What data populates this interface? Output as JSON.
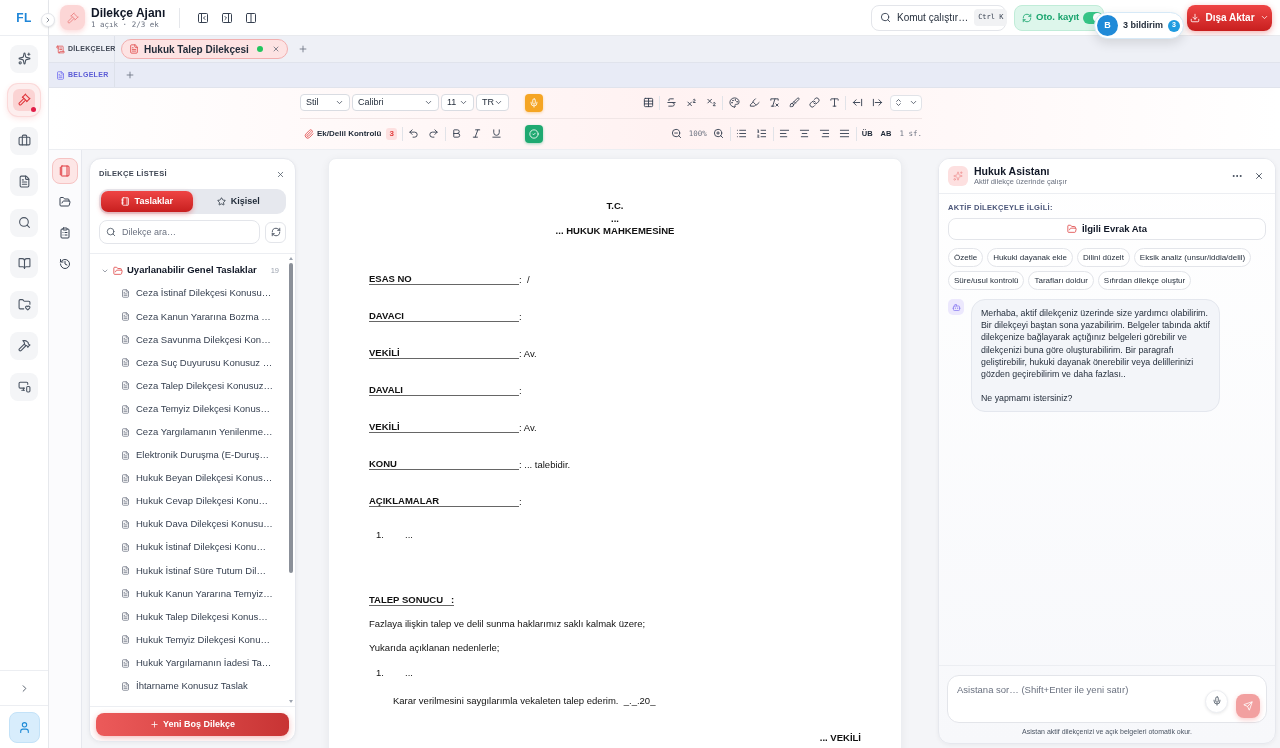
{
  "rail": {
    "logo": "FL",
    "items": [
      {
        "selected": false,
        "alert": false
      },
      {
        "selected": true,
        "alert": true
      },
      {
        "selected": false,
        "alert": false
      },
      {
        "selected": false,
        "alert": false
      },
      {
        "selected": false,
        "alert": false
      },
      {
        "selected": false,
        "alert": false
      },
      {
        "selected": false,
        "alert": false
      },
      {
        "selected": false,
        "alert": false
      },
      {
        "selected": false,
        "alert": false
      }
    ]
  },
  "topbar": {
    "title": "Dilekçe Ajanı",
    "subtitle": "1 açık · 2/3 ek",
    "command": {
      "label": "Komut çalıştır…",
      "shortcut": "Ctrl K"
    },
    "autosave": {
      "label": "Oto. kayıt",
      "on": true
    },
    "export_button": "Dışa Aktar",
    "notification": {
      "initial": "B",
      "label": "3 bildirim",
      "count": "3"
    }
  },
  "tab_groups": [
    {
      "kind": "petitions",
      "label": "DİLEKÇELER",
      "tabs": [
        {
          "label": "Hukuk Talep Dilekçesi",
          "selected": true,
          "saved": true
        }
      ]
    },
    {
      "kind": "documents",
      "label": "BELGELER"
    }
  ],
  "toolbar": {
    "style": "Stil",
    "font": "Calibri",
    "size": "11",
    "language": "TR",
    "evidence_check": {
      "label": "Ek/Delil Kontrolü",
      "count": "3"
    },
    "zoom": "100%",
    "case_buttons": [
      "ÜB",
      "AB"
    ],
    "page_count": "1 sf."
  },
  "panel_rail": {
    "items": [
      {
        "selected": true
      },
      {
        "selected": false
      },
      {
        "selected": false
      },
      {
        "selected": false
      }
    ]
  },
  "petition_list": {
    "title": "DİLEKÇE LİSTESİ",
    "segments": [
      {
        "label": "Taslaklar",
        "selected": true
      },
      {
        "label": "Kişisel",
        "selected": false
      }
    ],
    "search_placeholder": "Dilekçe ara…",
    "folders": [
      {
        "label": "Uyarlanabilir Genel Taslaklar",
        "count": "19",
        "expanded": true,
        "children": [
          {
            "label": "Ceza İstinaf Dilekçesi Konusu…"
          },
          {
            "label": "Ceza Kanun Yararına Bozma …"
          },
          {
            "label": "Ceza Savunma Dilekçesi Kon…"
          },
          {
            "label": "Ceza Suç Duyurusu Konusuz …"
          },
          {
            "label": "Ceza Talep Dilekçesi Konusuz…"
          },
          {
            "label": "Ceza Temyiz Dilekçesi Konus…"
          },
          {
            "label": "Ceza Yargılamanın Yenilenme…"
          },
          {
            "label": "Elektronik Duruşma (E-Duruş…"
          },
          {
            "label": "Hukuk Beyan Dilekçesi Konus…"
          },
          {
            "label": "Hukuk Cevap Dilekçesi Konu…"
          },
          {
            "label": "Hukuk Dava Dilekçesi Konusu…"
          },
          {
            "label": "Hukuk İstinaf Dilekçesi Konu…"
          },
          {
            "label": "Hukuk İstinaf Süre Tutum Dil…"
          },
          {
            "label": "Hukuk Kanun Yararına Temyiz…"
          },
          {
            "label": "Hukuk Talep Dilekçesi Konus…"
          },
          {
            "label": "Hukuk Temyiz Dilekçesi Konu…"
          },
          {
            "label": "Hukuk Yargılamanın İadesi Ta…"
          },
          {
            "label": "İhtarname Konusuz Taslak"
          }
        ]
      }
    ],
    "new_button": "Yeni Boş Dilekçe"
  },
  "document": {
    "heading": [
      "T.C.",
      "...",
      "... HUKUK MAHKEMESİNE"
    ],
    "fields": [
      {
        "label": "ESAS NO",
        "value": ":  /"
      },
      {
        "label": "DAVACI",
        "value": ":"
      },
      {
        "label": "VEKİLİ",
        "value": ": Av."
      },
      {
        "label": "DAVALI",
        "value": ":"
      },
      {
        "label": "VEKİLİ",
        "value": ": Av."
      },
      {
        "label": "KONU",
        "value": ": ... talebidir."
      },
      {
        "label": "AÇIKLAMALAR",
        "value": ":"
      }
    ],
    "explanations": [
      {
        "number": "1.",
        "text": "..."
      }
    ],
    "result_heading": "TALEP SONUCU   :",
    "result_paragraphs": [
      "Fazlaya ilişkin talep ve delil sunma haklarımız saklı kalmak üzere;",
      "Yukarıda açıklanan nedenlerle;"
    ],
    "result_items": [
      {
        "number": "1.",
        "text": "..."
      }
    ],
    "closing": "Karar verilmesini saygılarımla vekaleten talep ederim.  _._.20_",
    "signature": "... VEKİLİ"
  },
  "assistant": {
    "title": "Hukuk Asistanı",
    "subtitle": "Aktif dilekçe üzerinde çalışır",
    "section_label": "AKTİF DİLEKÇEYLE İLGİLİ:",
    "attach_button": "İlgili Evrak Ata",
    "chips": [
      "Özetle",
      "Hukuki dayanak ekle",
      "Dilini düzelt",
      "Eksik analiz (unsur/iddia/delil)",
      "Süre/usul kontrolü",
      "Tarafları doldur",
      "Sıfırdan dilekçe oluştur"
    ],
    "messages": [
      {
        "kind": "bot",
        "paragraphs": [
          "Merhaba, aktif dilekçeniz üzerinde size yardımcı olabilirim. Bir dilekçeyi baştan sona yazabilirim. Belgeler tabında aktif dilekçenize bağlayarak açtığınız belgeleri görebilir ve dilekçenizi buna göre oluşturabilirim. Bir paragrafı geliştirebilir, hukuki dayanak önerebilir veya delillerinizi gözden geçirebilirim ve daha fazlası..",
          "Ne yapmamı istersiniz?"
        ]
      }
    ],
    "input_placeholder": "Asistana sor… (Shift+Enter ile yeni satır)",
    "footer": "Asistan aktif dilekçenizi ve açık belgeleri otomatik okur."
  }
}
